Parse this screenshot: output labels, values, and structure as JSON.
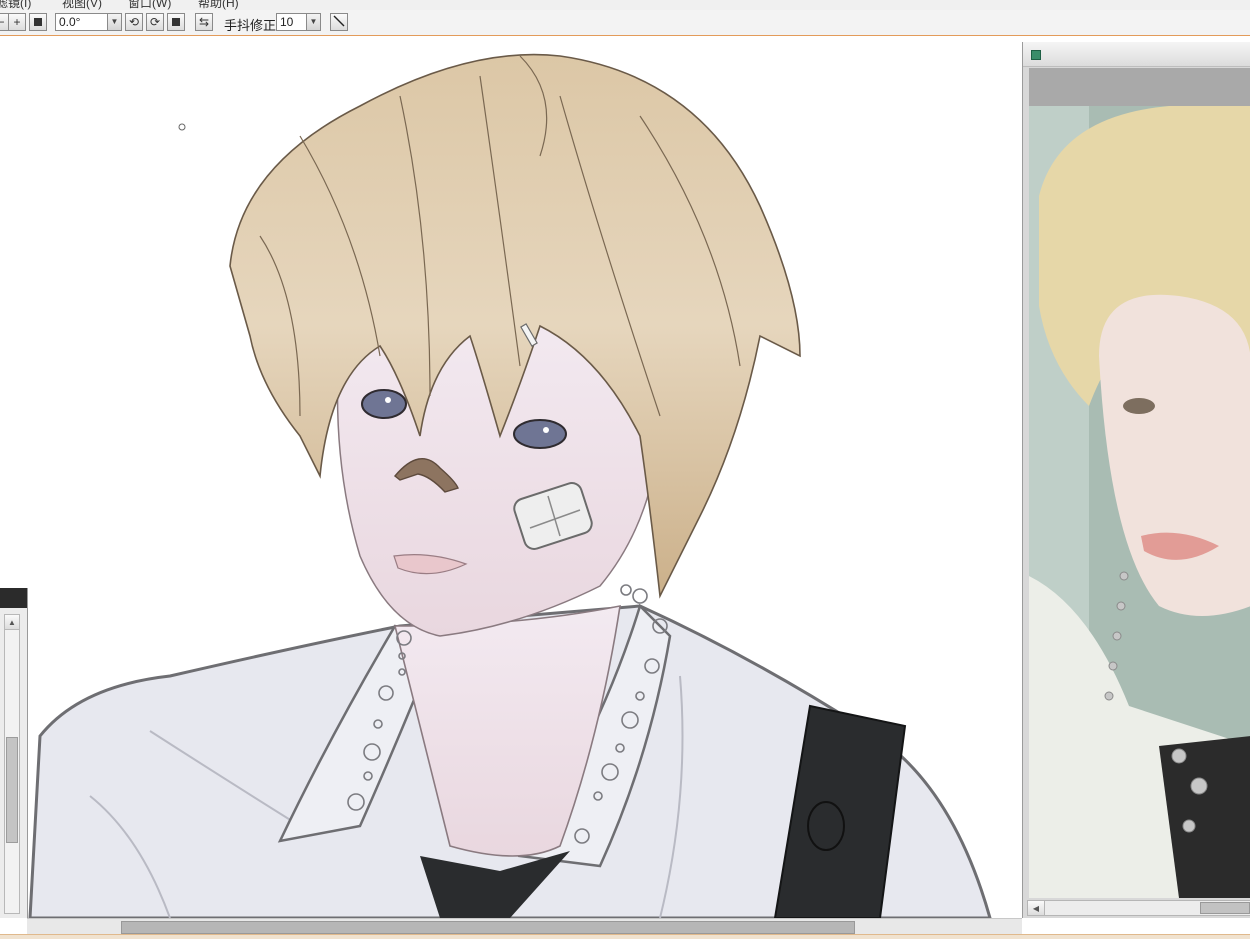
{
  "menubar": {
    "items": [
      "滤镜(I)",
      "视图(V)",
      "窗口(W)",
      "帮助(H)"
    ]
  },
  "toolbar": {
    "angle_value": "0.0°",
    "rotate_left_icon": "rotate-left-icon",
    "rotate_right_icon": "rotate-right-icon",
    "reset_icon": "reset-icon",
    "flip_icon": "flip-horizontal-icon",
    "stabilizer_label": "手抖修正",
    "stabilizer_value": "10",
    "line_tool_icon": "line-tool-icon"
  },
  "colors": {
    "toolbar_accent": "#e39b5a",
    "hair": "#d9c4a4",
    "shirt": "#e9eaf0",
    "strap": "#2a2c2e",
    "photo_bg": "#9fb6ad"
  }
}
